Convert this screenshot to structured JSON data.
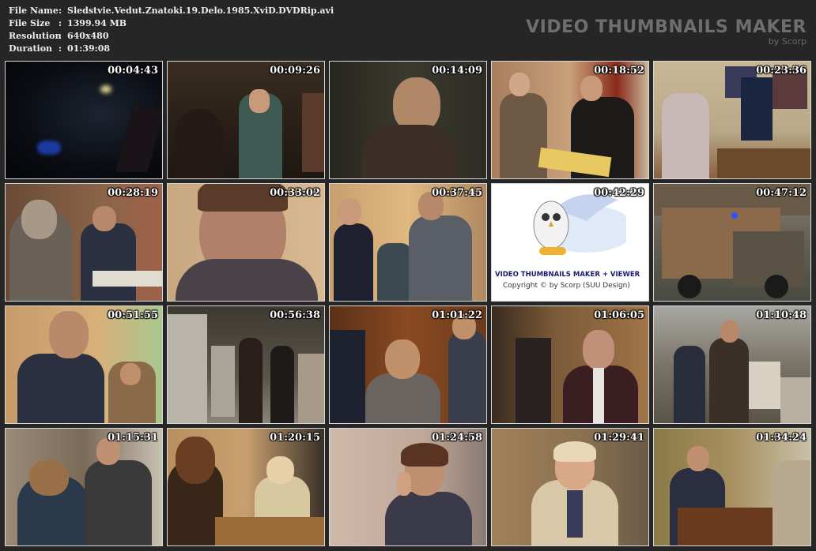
{
  "file_info": {
    "rows": [
      {
        "label": "File Name",
        "value": "Sledstvie.Vedut.Znatoki.19.Delo.1985.XviD.DVDRip.avi"
      },
      {
        "label": "File Size",
        "value": "1399.94 MB"
      },
      {
        "label": "Resolution",
        "value": "640x480"
      },
      {
        "label": "Duration",
        "value": "01:39:08"
      }
    ],
    "separator": ":"
  },
  "brand": {
    "title": "VIDEO THUMBNAILS MAKER",
    "subtitle": "by Scorp"
  },
  "logo_frame": {
    "title": "VIDEO THUMBNAILS MAKER + VIEWER",
    "copyright": "Copyright © by Scorp (SUU Design)"
  },
  "thumbnails": [
    {
      "time": "00:04:43"
    },
    {
      "time": "00:09:26"
    },
    {
      "time": "00:14:09"
    },
    {
      "time": "00:18:52"
    },
    {
      "time": "00:23:36"
    },
    {
      "time": "00:28:19"
    },
    {
      "time": "00:33:02"
    },
    {
      "time": "00:37:45"
    },
    {
      "time": "00:42:29"
    },
    {
      "time": "00:47:12"
    },
    {
      "time": "00:51:55"
    },
    {
      "time": "00:56:38"
    },
    {
      "time": "01:01:22"
    },
    {
      "time": "01:06:05"
    },
    {
      "time": "01:10:48"
    },
    {
      "time": "01:15:31"
    },
    {
      "time": "01:20:15"
    },
    {
      "time": "01:24:58"
    },
    {
      "time": "01:29:41"
    },
    {
      "time": "01:34:24"
    }
  ]
}
